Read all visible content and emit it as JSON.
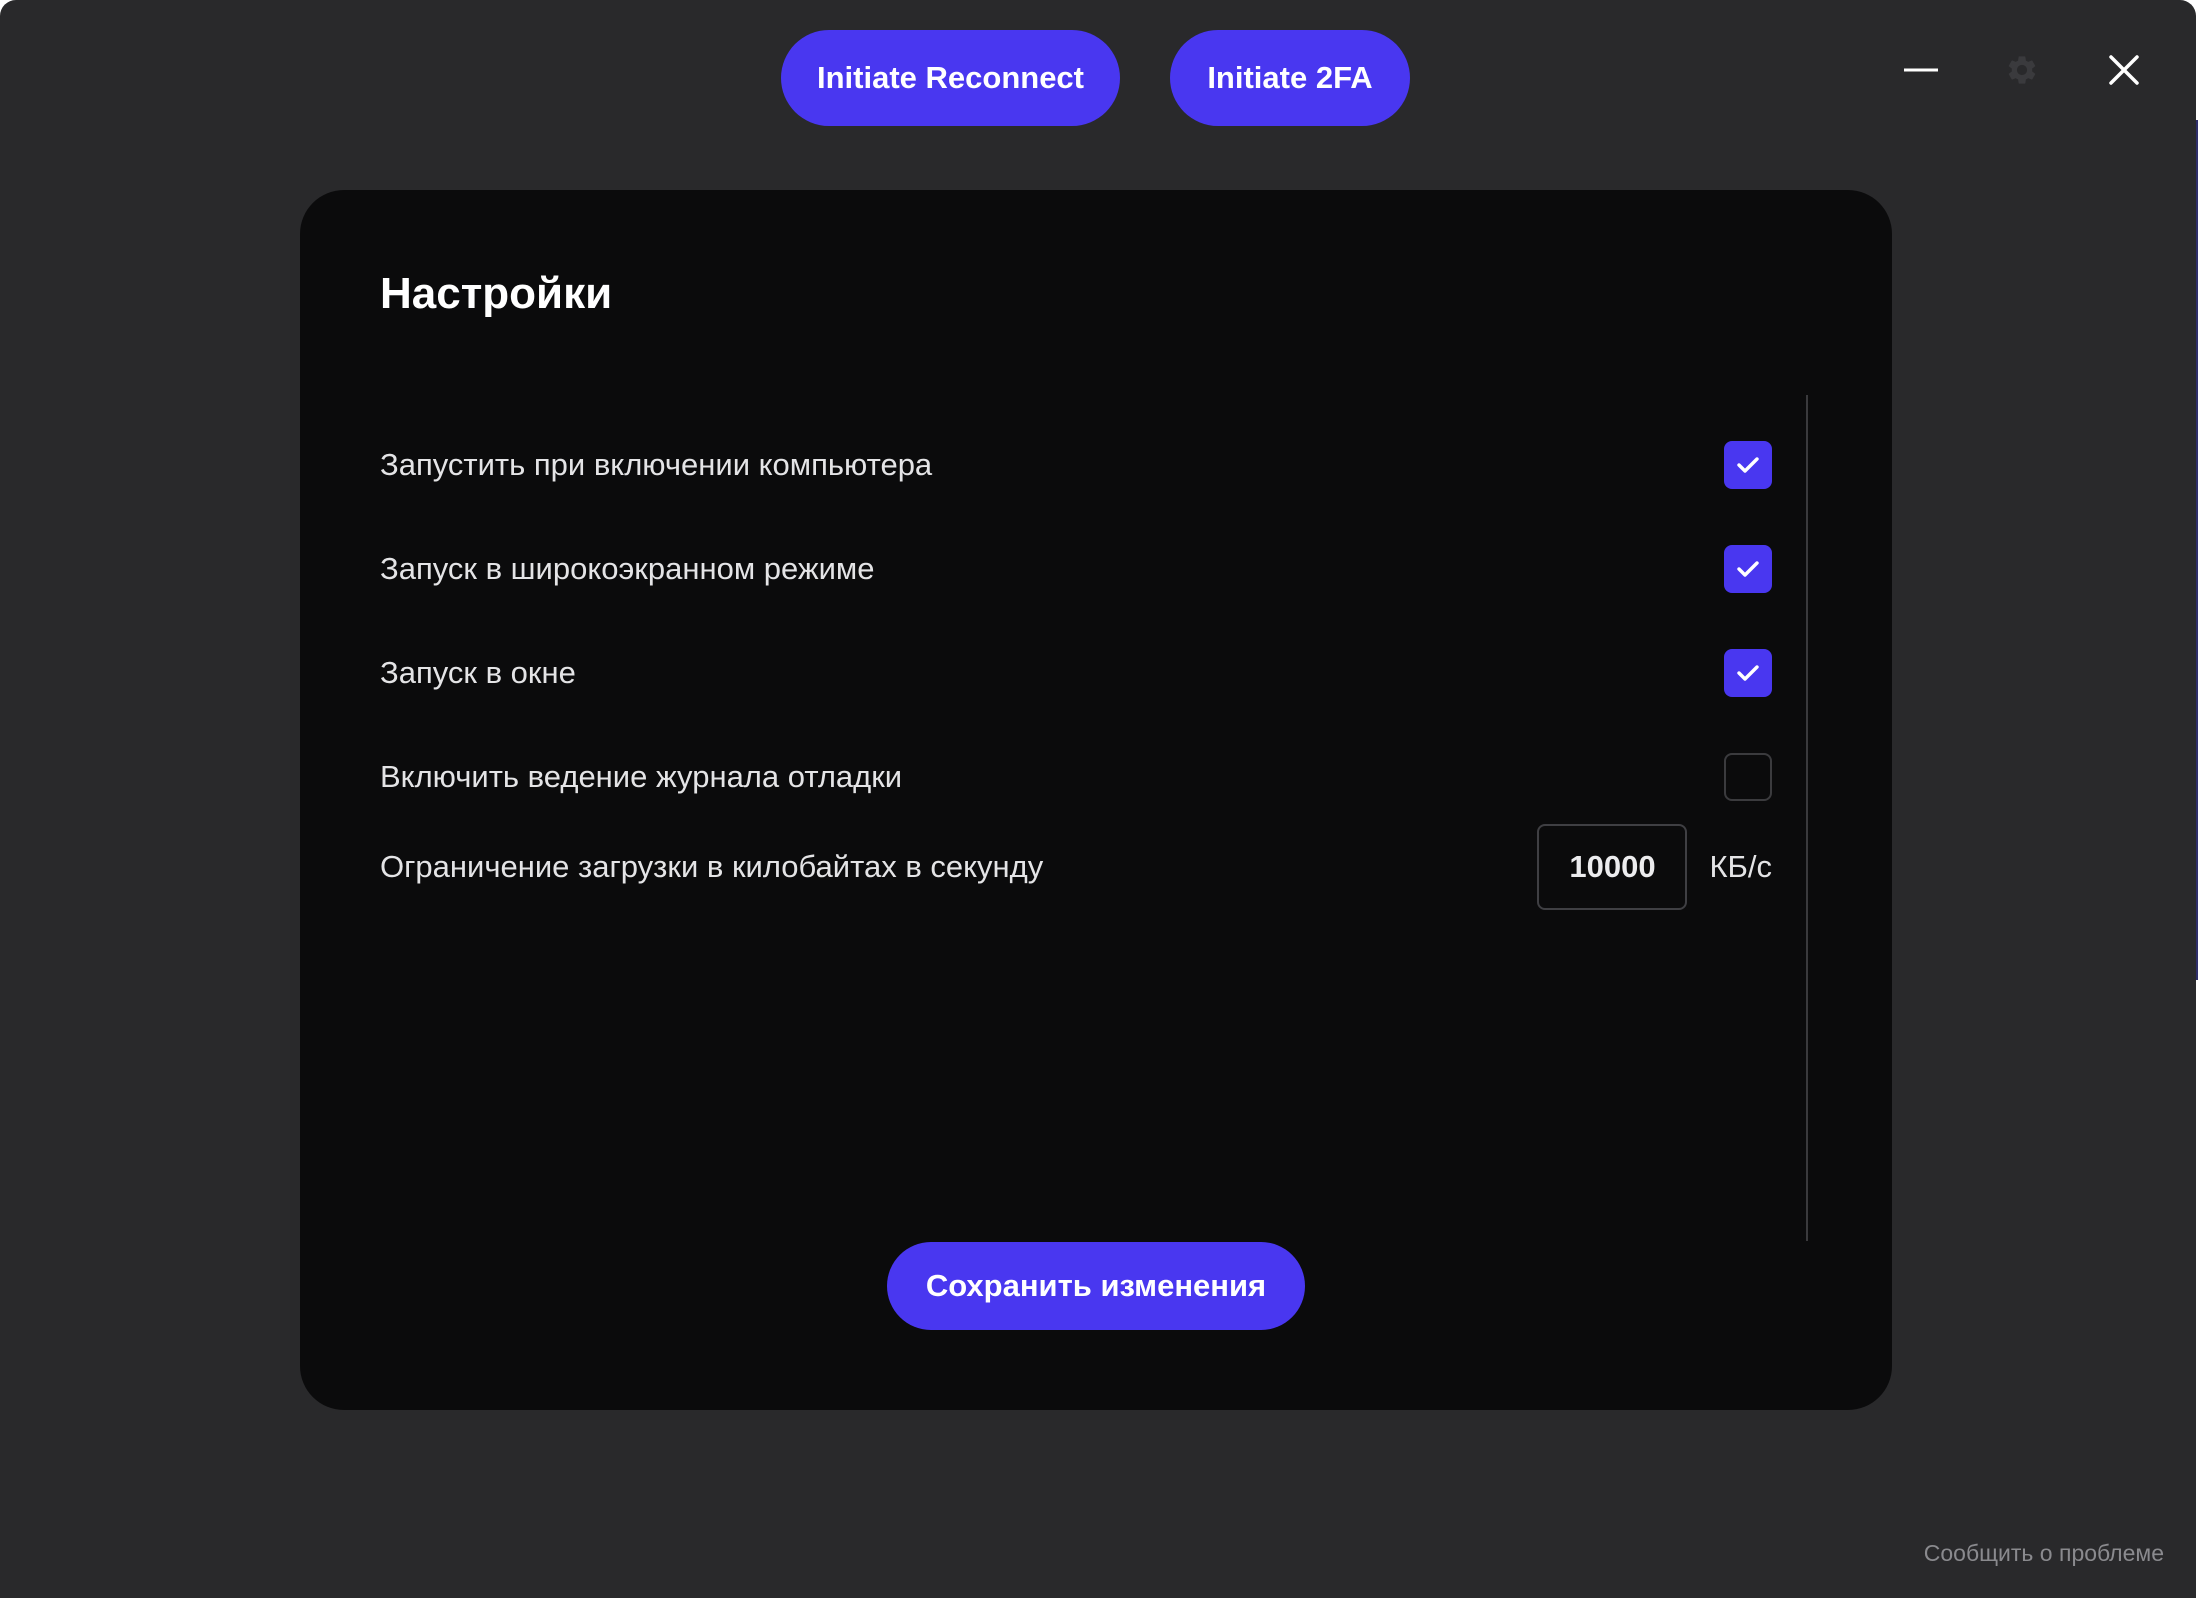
{
  "top_actions": {
    "reconnect_label": "Initiate Reconnect",
    "twofa_label": "Initiate 2FA"
  },
  "window_controls": {
    "minimize_icon": "minimize-icon",
    "settings_icon": "gear-icon",
    "close_icon": "close-icon"
  },
  "settings": {
    "title": "Настройки",
    "options": [
      {
        "label": "Запустить при включении компьютера",
        "checked": true
      },
      {
        "label": "Запуск в широкоэкранном режиме",
        "checked": true
      },
      {
        "label": "Запуск в окне",
        "checked": true
      },
      {
        "label": "Включить ведение журнала отладки",
        "checked": false
      }
    ],
    "download_limit": {
      "label": "Ограничение загрузки в килобайтах в секунду",
      "value": "10000",
      "unit": "КБ/с"
    },
    "save_label": "Сохранить изменения"
  },
  "footer": {
    "report_label": "Сообщить о проблеме"
  },
  "colors": {
    "accent": "#4937f0",
    "window_bg": "#29292b",
    "panel_bg": "#0b0b0c"
  }
}
